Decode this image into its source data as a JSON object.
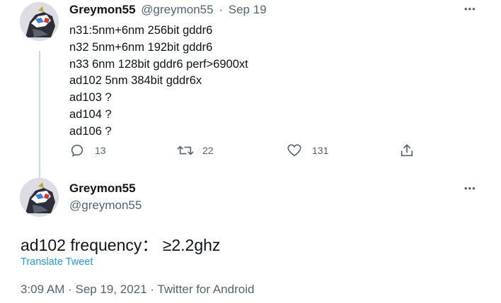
{
  "tweet1": {
    "author_name": "Greymon55",
    "handle": "@greymon55",
    "separator": "·",
    "date": "Sep 19",
    "more_label": "•••",
    "lines": [
      "n31:5nm+6nm 256bit gddr6",
      "n32 5nm+6nm 192bit gddr6",
      "n33 6nm 128bit gddr6 perf>6900xt",
      "ad102 5nm 384bit gddr6x",
      "ad103 ?",
      "ad104 ?",
      "ad106 ?"
    ],
    "actions": {
      "reply_icon": "reply-icon",
      "reply_count": "13",
      "retweet_icon": "retweet-icon",
      "retweet_count": "22",
      "like_icon": "heart-icon",
      "like_count": "131",
      "share_icon": "share-icon"
    }
  },
  "tweet2": {
    "author_name": "Greymon55",
    "handle": "@greymon55",
    "more_label": "•••",
    "text": "ad102 frequency： ≥2.2ghz",
    "translate_label": "Translate Tweet",
    "meta": "3:09 AM · Sep 19, 2021 · Twitter for Android"
  },
  "colors": {
    "text": "#0f1419",
    "muted": "#536471",
    "link": "#1d9bf0",
    "thread_line": "#cfd9de"
  }
}
